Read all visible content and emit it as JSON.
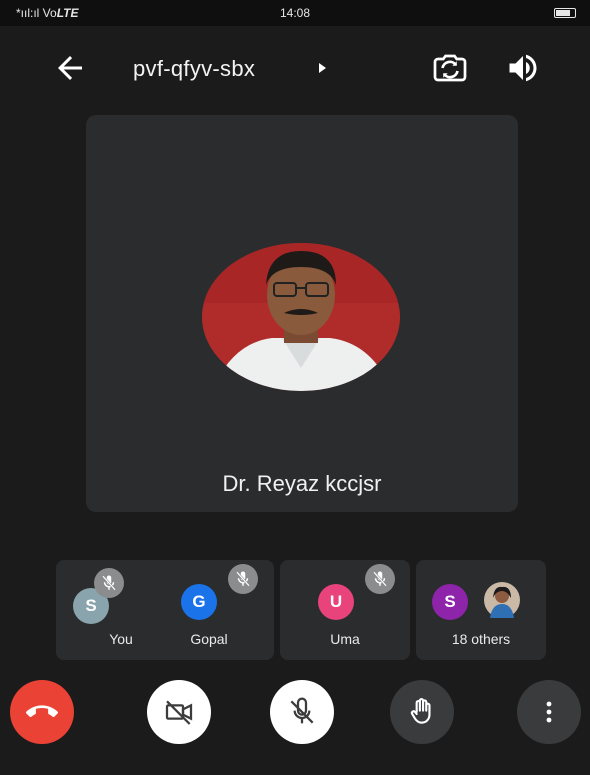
{
  "status_bar": {
    "carrier": "*ııl:ıl Vo",
    "network": "LTE",
    "time": "14:08"
  },
  "header": {
    "meeting_code": "pvf-qfyv-sbx"
  },
  "main_tile": {
    "presenter_name": "Dr. Reyaz kccjsr"
  },
  "participants": [
    {
      "name": "You",
      "initial": "S",
      "avatar_color": "#8aa4ad",
      "muted": true
    },
    {
      "name": "Gopal",
      "initial": "G",
      "avatar_color": "#1a73e8",
      "muted": true
    },
    {
      "name": "Uma",
      "initial": "U",
      "avatar_color": "#e8437a",
      "muted": true
    },
    {
      "name": "18 others",
      "initial": "S",
      "avatar_color": "#8e24aa",
      "muted": false
    }
  ],
  "controls": {
    "end_call_icon": "phone-hangup-icon",
    "camera_icon": "camera-off-icon",
    "mic_icon": "mic-off-icon",
    "hand_icon": "raise-hand-icon",
    "more_icon": "more-vertical-icon"
  },
  "colors": {
    "end_call": "#ea4335",
    "background": "#1b1b1c",
    "tile": "#2b2c2e"
  }
}
